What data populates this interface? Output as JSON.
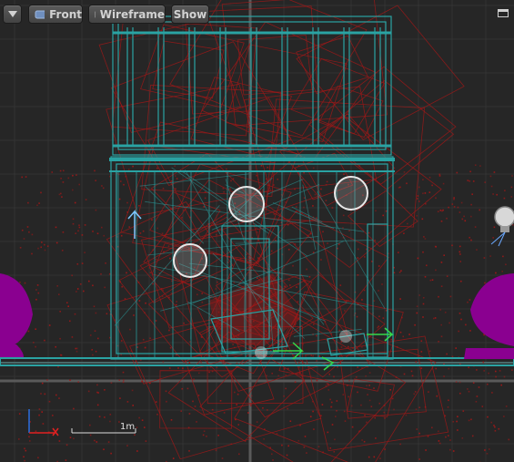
{
  "toolbar": {
    "menu_icon": "chevron-down-icon",
    "view_mode": "Front",
    "view_mode_icon": "ortho-camera-icon",
    "render_mode": "Wireframe",
    "render_mode_icon": "wireframe-cube-icon",
    "show_label": "Show",
    "maximize_icon": "maximize-icon"
  },
  "scale": {
    "label": "1m"
  },
  "axis_gizmo": {
    "up_axis": "Z",
    "right_axis": "X"
  },
  "colors": {
    "background": "#262626",
    "grid": "#333333",
    "wireframe_mesh": "#2aa3a3",
    "particle_wire": "#a01818",
    "light_sphere": "#8a0090",
    "gizmo_green": "#35d94a",
    "gizmo_blue": "#2b6fe0",
    "gizmo_red": "#e02020"
  }
}
